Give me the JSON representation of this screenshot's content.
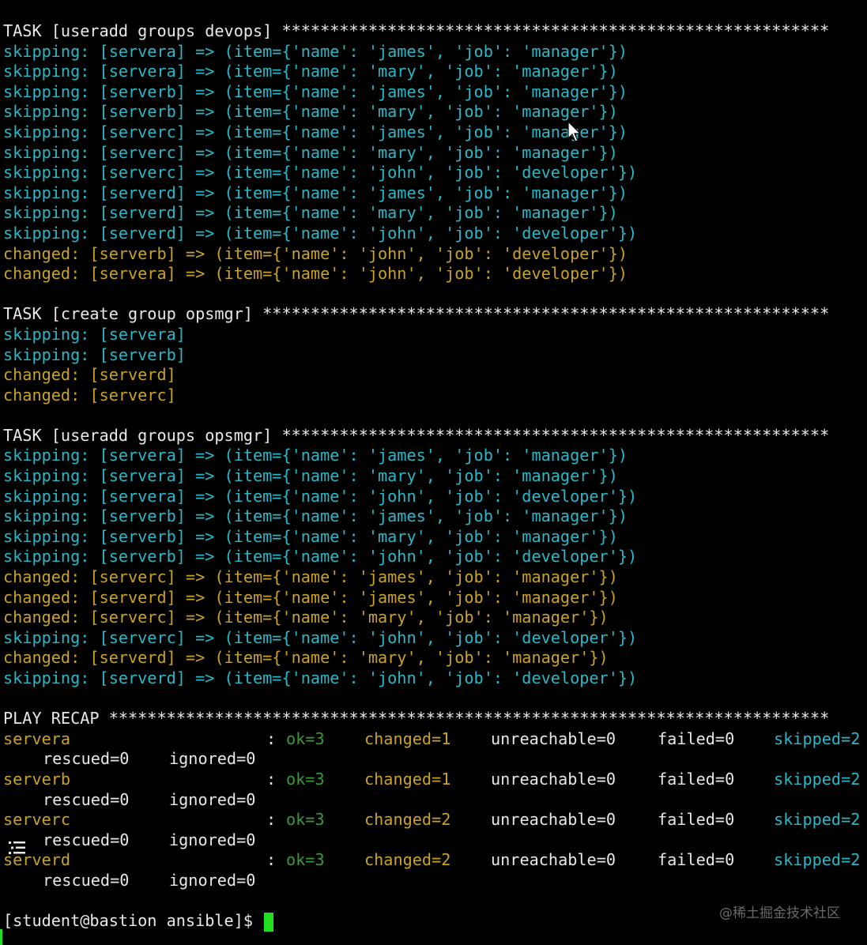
{
  "terminal": {
    "lines": [
      {
        "kind": "task",
        "text": "TASK [useradd groups devops] *********************************************************"
      },
      {
        "kind": "skip",
        "text": "skipping: [servera] => (item={'name': 'james', 'job': 'manager'})"
      },
      {
        "kind": "skip",
        "text": "skipping: [servera] => (item={'name': 'mary', 'job': 'manager'})"
      },
      {
        "kind": "skip",
        "text": "skipping: [serverb] => (item={'name': 'james', 'job': 'manager'})"
      },
      {
        "kind": "skip",
        "text": "skipping: [serverb] => (item={'name': 'mary', 'job': 'manager'})"
      },
      {
        "kind": "skip",
        "text": "skipping: [serverc] => (item={'name': 'james', 'job': 'manager'})"
      },
      {
        "kind": "skip",
        "text": "skipping: [serverc] => (item={'name': 'mary', 'job': 'manager'})"
      },
      {
        "kind": "skip",
        "text": "skipping: [serverc] => (item={'name': 'john', 'job': 'developer'})"
      },
      {
        "kind": "skip",
        "text": "skipping: [serverd] => (item={'name': 'james', 'job': 'manager'})"
      },
      {
        "kind": "skip",
        "text": "skipping: [serverd] => (item={'name': 'mary', 'job': 'manager'})"
      },
      {
        "kind": "skip",
        "text": "skipping: [serverd] => (item={'name': 'john', 'job': 'developer'})"
      },
      {
        "kind": "chg",
        "text": "changed: [serverb] => (item={'name': 'john', 'job': 'developer'})"
      },
      {
        "kind": "chg",
        "text": "changed: [servera] => (item={'name': 'john', 'job': 'developer'})"
      },
      {
        "kind": "blank",
        "text": ""
      },
      {
        "kind": "task",
        "text": "TASK [create group opsmgr] ***********************************************************"
      },
      {
        "kind": "skip",
        "text": "skipping: [servera]"
      },
      {
        "kind": "skip",
        "text": "skipping: [serverb]"
      },
      {
        "kind": "chg",
        "text": "changed: [serverd]"
      },
      {
        "kind": "chg",
        "text": "changed: [serverc]"
      },
      {
        "kind": "blank",
        "text": ""
      },
      {
        "kind": "task",
        "text": "TASK [useradd groups opsmgr] *********************************************************"
      },
      {
        "kind": "skip",
        "text": "skipping: [servera] => (item={'name': 'james', 'job': 'manager'})"
      },
      {
        "kind": "skip",
        "text": "skipping: [servera] => (item={'name': 'mary', 'job': 'manager'})"
      },
      {
        "kind": "skip",
        "text": "skipping: [servera] => (item={'name': 'john', 'job': 'developer'})"
      },
      {
        "kind": "skip",
        "text": "skipping: [serverb] => (item={'name': 'james', 'job': 'manager'})"
      },
      {
        "kind": "skip",
        "text": "skipping: [serverb] => (item={'name': 'mary', 'job': 'manager'})"
      },
      {
        "kind": "skip",
        "text": "skipping: [serverb] => (item={'name': 'john', 'job': 'developer'})"
      },
      {
        "kind": "chg",
        "text": "changed: [serverc] => (item={'name': 'james', 'job': 'manager'})"
      },
      {
        "kind": "chg",
        "text": "changed: [serverd] => (item={'name': 'james', 'job': 'manager'})"
      },
      {
        "kind": "chg",
        "text": "changed: [serverc] => (item={'name': 'mary', 'job': 'manager'})"
      },
      {
        "kind": "skip",
        "text": "skipping: [serverc] => (item={'name': 'john', 'job': 'developer'})"
      },
      {
        "kind": "chg",
        "text": "changed: [serverd] => (item={'name': 'mary', 'job': 'manager'})"
      },
      {
        "kind": "skip",
        "text": "skipping: [serverd] => (item={'name': 'john', 'job': 'developer'})"
      },
      {
        "kind": "blank",
        "text": ""
      },
      {
        "kind": "task",
        "text": "PLAY RECAP ***************************************************************************"
      }
    ]
  },
  "recap": {
    "hosts": [
      {
        "host": "servera",
        "sep": ":",
        "ok": "ok=3",
        "changed": "changed=1",
        "unreachable": "unreachable=0",
        "failed": "failed=0",
        "skipped": "skipped=2",
        "rescued": "rescued=0",
        "ignored": "ignored=0"
      },
      {
        "host": "serverb",
        "sep": ":",
        "ok": "ok=3",
        "changed": "changed=1",
        "unreachable": "unreachable=0",
        "failed": "failed=0",
        "skipped": "skipped=2",
        "rescued": "rescued=0",
        "ignored": "ignored=0"
      },
      {
        "host": "serverc",
        "sep": ":",
        "ok": "ok=3",
        "changed": "changed=2",
        "unreachable": "unreachable=0",
        "failed": "failed=0",
        "skipped": "skipped=2",
        "rescued": "rescued=0",
        "ignored": "ignored=0"
      },
      {
        "host": "serverd",
        "sep": ":",
        "ok": "ok=3",
        "changed": "changed=2",
        "unreachable": "unreachable=0",
        "failed": "failed=0",
        "skipped": "skipped=2",
        "rescued": "rescued=0",
        "ignored": "ignored=0"
      }
    ]
  },
  "prompt": {
    "text": "[student@bastion ansible]$ "
  },
  "watermark": {
    "text": "@稀土掘金技术社区"
  },
  "icons": {
    "list": "list-icon",
    "pointer": "mouse-pointer-icon"
  },
  "colors": {
    "background": "#000000",
    "task": "#e8e8e8",
    "skipped": "#2ab8c8",
    "changed": "#c9a227",
    "ok": "#3a9a3a",
    "cursor": "#22dd22"
  }
}
